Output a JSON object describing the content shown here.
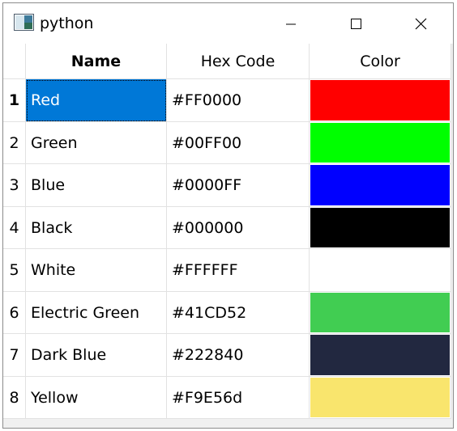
{
  "window": {
    "title": "python"
  },
  "table": {
    "headers": {
      "name": "Name",
      "hex": "Hex Code",
      "color": "Color"
    },
    "selected_row": 1,
    "rows": [
      {
        "index": "1",
        "name": "Red",
        "hex": "#FF0000",
        "color": "#FF0000"
      },
      {
        "index": "2",
        "name": "Green",
        "hex": "#00FF00",
        "color": "#00FF00"
      },
      {
        "index": "3",
        "name": "Blue",
        "hex": "#0000FF",
        "color": "#0000FF"
      },
      {
        "index": "4",
        "name": "Black",
        "hex": "#000000",
        "color": "#000000"
      },
      {
        "index": "5",
        "name": "White",
        "hex": "#FFFFFF",
        "color": "#FFFFFF"
      },
      {
        "index": "6",
        "name": "Electric Green",
        "hex": "#41CD52",
        "color": "#41CD52"
      },
      {
        "index": "7",
        "name": "Dark Blue",
        "hex": "#222840",
        "color": "#222840"
      },
      {
        "index": "8",
        "name": "Yellow",
        "hex": "#F9E56d",
        "color": "#F9E56D"
      }
    ]
  },
  "colors": {
    "selection": "#0078d7",
    "grid": "#e2e2e2"
  }
}
